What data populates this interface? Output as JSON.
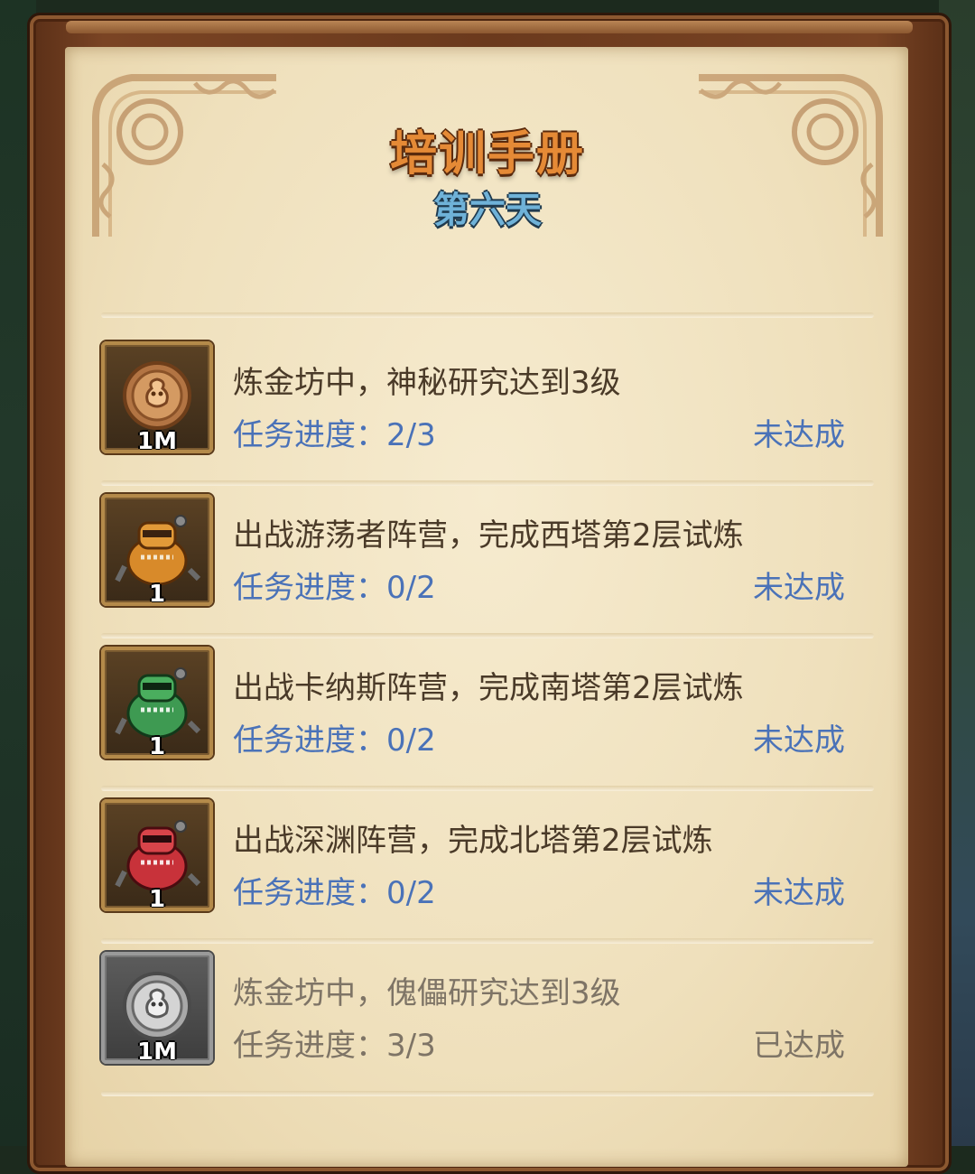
{
  "header": {
    "title": "培训手册",
    "subtitle": "第六天"
  },
  "tasks": [
    {
      "description": "炼金坊中，神秘研究达到3级",
      "progress_label": "任务进度：",
      "progress": "2/3",
      "status": "未达成",
      "reward": {
        "icon": "bronze-coin-icon",
        "quantity": "1M"
      },
      "completed": false
    },
    {
      "description": "出战游荡者阵营，完成西塔第2层试炼",
      "progress_label": "任务进度：",
      "progress": "0/2",
      "status": "未达成",
      "reward": {
        "icon": "orange-robot-icon",
        "quantity": "1"
      },
      "completed": false
    },
    {
      "description": "出战卡纳斯阵营，完成南塔第2层试炼",
      "progress_label": "任务进度：",
      "progress": "0/2",
      "status": "未达成",
      "reward": {
        "icon": "green-robot-icon",
        "quantity": "1"
      },
      "completed": false
    },
    {
      "description": "出战深渊阵营，完成北塔第2层试炼",
      "progress_label": "任务进度：",
      "progress": "0/2",
      "status": "未达成",
      "reward": {
        "icon": "red-robot-icon",
        "quantity": "1"
      },
      "completed": false
    },
    {
      "description": "炼金坊中，傀儡研究达到3级",
      "progress_label": "任务进度：",
      "progress": "3/3",
      "status": "已达成",
      "reward": {
        "icon": "silver-coin-icon",
        "quantity": "1M"
      },
      "completed": true
    }
  ],
  "colors": {
    "pending_text": "#4a72b8",
    "completed_text": "#7e7466",
    "title": "#e58a36",
    "subtitle": "#6fb2d8"
  }
}
